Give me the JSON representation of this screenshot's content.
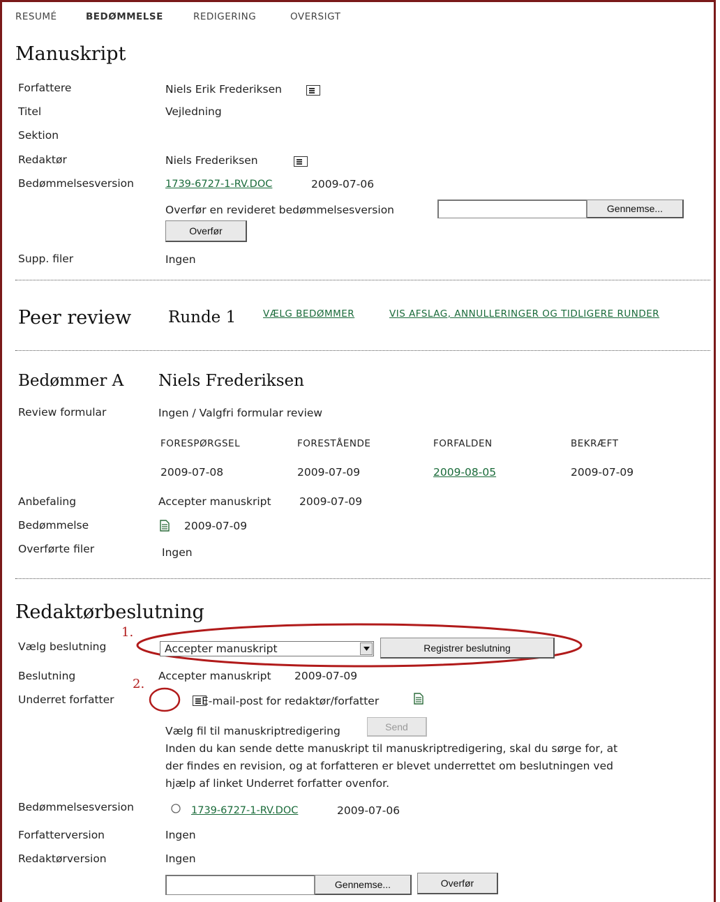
{
  "nav": {
    "items": [
      "RESUMÉ",
      "BEDØMMELSE",
      "REDIGERING",
      "OVERSIGT"
    ]
  },
  "manuscript": {
    "heading": "Manuskript",
    "authors_label": "Forfattere",
    "authors_value": "Niels Erik Frederiksen",
    "title_label": "Titel",
    "title_value": "Vejledning",
    "section_label": "Sektion",
    "editor_label": "Redaktør",
    "editor_value": "Niels Frederiksen",
    "review_version_label": "Bedømmelsesversion",
    "review_version_file": "1739-6727-1-RV.DOC",
    "review_version_date": "2009-07-06",
    "upload_revised_label": "Overfør en revideret bedømmelsesversion",
    "browse_button": "Gennemse...",
    "upload_button": "Overfør",
    "supp_files_label": "Supp. filer",
    "supp_files_value": "Ingen"
  },
  "peer_review": {
    "heading": "Peer review",
    "round": "Runde 1",
    "select_reviewer_link": "VÆLG BEDØMMER",
    "show_declined_link": "VIS AFSLAG, ANNULLERINGER OG TIDLIGERE RUNDER"
  },
  "reviewer": {
    "heading_label": "Bedømmer A",
    "heading_name": "Niels Frederiksen",
    "form_label": "Review formular",
    "form_value": "Ingen / Valgfri formular review",
    "columns": [
      "FORESPØRGSEL",
      "FORESTÅENDE",
      "FORFALDEN",
      "BEKRÆFT"
    ],
    "dates": [
      "2009-07-08",
      "2009-07-09",
      "2009-08-05",
      "2009-07-09"
    ],
    "recommendation_label": "Anbefaling",
    "recommendation_value": "Accepter manuskript",
    "recommendation_date": "2009-07-09",
    "review_label": "Bedømmelse",
    "review_date": "2009-07-09",
    "uploaded_files_label": "Overførte filer",
    "uploaded_files_value": "Ingen"
  },
  "decision": {
    "heading": "Redaktørbeslutning",
    "select_label": "Vælg beslutning",
    "select_value": "Accepter manuskript",
    "register_button": "Registrer beslutning",
    "decision_label": "Beslutning",
    "decision_value": "Accepter manuskript",
    "decision_date": "2009-07-09",
    "notify_label": "Underret forfatter",
    "email_log_label": "E-mail-post for redaktør/forfatter",
    "select_file_label": "Vælg fil til manuskriptredigering",
    "send_button": "Send",
    "info_line1": "Inden du kan sende dette manuskript til manuskriptredigering, skal du sørge for, at",
    "info_line2": "der findes en revision, og at forfatteren er blevet underrettet om beslutningen ved",
    "info_line3": "hjælp af linket Underret forfatter ovenfor.",
    "review_version_label": "Bedømmelsesversion",
    "review_version_file": "1739-6727-1-RV.DOC",
    "review_version_date": "2009-07-06",
    "author_version_label": "Forfatterversion",
    "author_version_value": "Ingen",
    "editor_version_label": "Redaktørversion",
    "editor_version_value": "Ingen",
    "browse_button": "Gennemse...",
    "upload_button": "Overfør"
  },
  "annotations": {
    "one": "1.",
    "two": "2.",
    "color": "#b11a1a"
  }
}
